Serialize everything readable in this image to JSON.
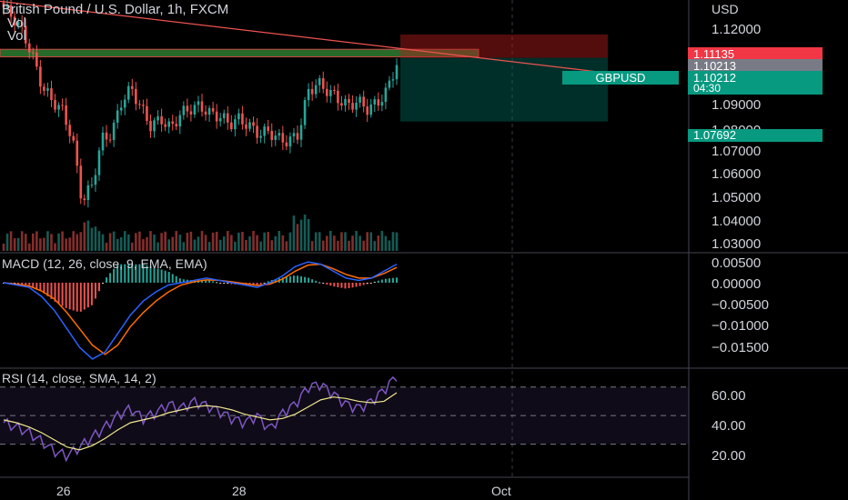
{
  "header": {
    "title": "British Pound / U.S. Dollar, 1h, FXCM",
    "vol_label_1": "Vol",
    "vol_label_2": "Vol",
    "currency": "USD"
  },
  "macd_title": "MACD (12, 26, close, 9, EMA, EMA)",
  "rsi_title": "RSI (14, close, SMA, 14, 2)",
  "price_tags": {
    "upper_target": "1.11135",
    "prev_close": "1.10213",
    "symbol": "GBPUSD",
    "last_price": "1.10212",
    "countdown": "04:30",
    "stop_level": "1.07692"
  },
  "colors": {
    "up": "#26a69a",
    "down": "#ef5350",
    "macd_line": "#2962ff",
    "signal_line": "#ff6d00",
    "rsi_line": "#7e57c2",
    "rsi_ma": "#f0e68c",
    "trendline": "#ef5350",
    "green_zone": "#2e7d32"
  },
  "chart_data": [
    {
      "type": "candlestick",
      "title": "British Pound / U.S. Dollar, 1h, FXCM",
      "ylabel": "USD",
      "ylim": [
        1.025,
        1.125
      ],
      "y_ticks": [
        "1.12000",
        "1.09000",
        "1.08000",
        "1.07000",
        "1.06000",
        "1.05000",
        "1.04000",
        "1.03000"
      ],
      "x_ticks": [
        "26",
        "28",
        "Oct"
      ],
      "ohlc_close_path": [
        1.122,
        1.118,
        1.112,
        1.102,
        1.09,
        1.085,
        1.081,
        1.07,
        1.045,
        1.052,
        1.07,
        1.072,
        1.085,
        1.09,
        1.082,
        1.075,
        1.078,
        1.074,
        1.08,
        1.082,
        1.083,
        1.08,
        1.079,
        1.076,
        1.078,
        1.075,
        1.072,
        1.073,
        1.07,
        1.069,
        1.072,
        1.089,
        1.092,
        1.089,
        1.086,
        1.083,
        1.085,
        1.082,
        1.084,
        1.089,
        1.1
      ],
      "horizontal_levels": {
        "green_zone": [
          1.1025,
          1.1055
        ],
        "upper_target": 1.11135,
        "last": 1.10212,
        "stop": 1.07692
      },
      "volume_label": "Vol"
    },
    {
      "type": "line",
      "title": "MACD (12, 26, close, 9, EMA, EMA)",
      "y_ticks": [
        "0.00500",
        "0.00000",
        "−0.00500",
        "−0.01000",
        "−0.01500"
      ],
      "ylim": [
        -0.0175,
        0.0055
      ],
      "series": [
        {
          "values": [
            0.0,
            -0.0005,
            -0.001,
            -0.003,
            -0.006,
            -0.01,
            -0.014,
            -0.0165,
            -0.015,
            -0.011,
            -0.007,
            -0.004,
            -0.002,
            -0.0005,
            0.0,
            0.0005,
            0.001,
            0.0005,
            0.0,
            -0.0005,
            -0.001,
            0.0,
            0.0015,
            0.0035,
            0.0045,
            0.004,
            0.0025,
            0.001,
            0.0005,
            0.001,
            0.0025,
            0.004
          ]
        },
        {
          "values": [
            0.0,
            -0.0003,
            -0.0007,
            -0.0018,
            -0.0035,
            -0.0065,
            -0.01,
            -0.0135,
            -0.0155,
            -0.0135,
            -0.0095,
            -0.0065,
            -0.004,
            -0.002,
            -0.0005,
            0.0002,
            0.0006,
            0.0005,
            0.0002,
            -0.0002,
            -0.0006,
            -0.0003,
            0.0008,
            0.0025,
            0.0038,
            0.004,
            0.003,
            0.0018,
            0.001,
            0.001,
            0.002,
            0.0033
          ]
        }
      ]
    },
    {
      "type": "line",
      "title": "RSI (14, close, SMA, 14, 2)",
      "y_ticks": [
        "60.00",
        "40.00",
        "20.00"
      ],
      "ylim": [
        10,
        80
      ],
      "bands": [
        70,
        50,
        30
      ],
      "series": [
        {
          "values": [
            45,
            42,
            38,
            32,
            25,
            22,
            28,
            35,
            42,
            50,
            55,
            48,
            52,
            58,
            55,
            60,
            57,
            53,
            48,
            45,
            50,
            40,
            52,
            58,
            70,
            72,
            65,
            58,
            55,
            60,
            68,
            78
          ]
        },
        {
          "values": [
            47,
            45,
            42,
            38,
            33,
            28,
            26,
            29,
            34,
            40,
            45,
            47,
            49,
            52,
            54,
            56,
            57,
            56,
            54,
            51,
            49,
            47,
            48,
            51,
            56,
            61,
            63,
            62,
            60,
            59,
            60,
            66
          ]
        }
      ]
    }
  ]
}
